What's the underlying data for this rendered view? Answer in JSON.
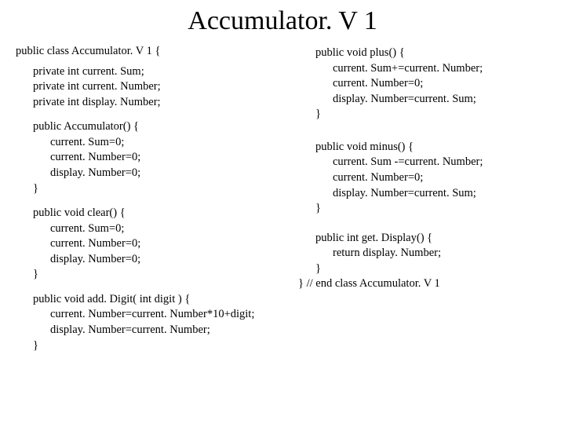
{
  "title": "Accumulator. V 1",
  "left": {
    "class_decl": "public class Accumulator. V 1 {",
    "f1": "private int current. Sum;",
    "f2": "private int current. Number;",
    "f3": "private int display. Number;",
    "ctor_head": "public Accumulator() {",
    "ctor_l1": "current. Sum=0;",
    "ctor_l2": "current. Number=0;",
    "ctor_l3": "display. Number=0;",
    "ctor_end": "}",
    "clear_head": "public void clear() {",
    "clear_l1": "current. Sum=0;",
    "clear_l2": "current. Number=0;",
    "clear_l3": "display. Number=0;",
    "clear_end": "}",
    "add_head": "public void add. Digit( int digit ) {",
    "add_l1": "current. Number=current. Number*10+digit;",
    "add_l2": "display. Number=current. Number;",
    "add_end": "}"
  },
  "right": {
    "plus_head": "public void plus() {",
    "plus_l1": "current. Sum+=current. Number;",
    "plus_l2": "current. Number=0;",
    "plus_l3": "display. Number=current. Sum;",
    "plus_end": "}",
    "minus_head": "public void minus() {",
    "minus_l1": "current. Sum -=current. Number;",
    "minus_l2": "current. Number=0;",
    "minus_l3": "display. Number=current. Sum;",
    "minus_end": "}",
    "get_head": "public int get. Display() {",
    "get_l1": "return display. Number;",
    "get_end": "}",
    "class_end": "} // end class Accumulator. V 1"
  }
}
